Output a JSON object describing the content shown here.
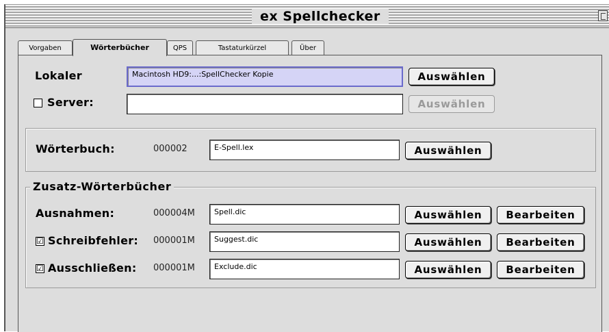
{
  "window": {
    "title": "ex Spellchecker"
  },
  "tabs": [
    {
      "label": "Vorgaben"
    },
    {
      "label": "Wörterbücher"
    },
    {
      "label": "QPS"
    },
    {
      "label": "Tastaturkürzel"
    },
    {
      "label": "Über"
    }
  ],
  "active_tab": "Wörterbücher",
  "location": {
    "lokaler_label": "Lokaler",
    "lokaler_path": "Macintosh HD9:...:SpellChecker Kopie",
    "server_label": "Server:",
    "server_checked": false,
    "server_path": "",
    "choose_label": "Auswählen"
  },
  "main_dict": {
    "label": "Wörterbuch:",
    "code": "000002",
    "file": "E-Spell.lex",
    "choose_label": "Auswählen"
  },
  "extra_dicts": {
    "title": "Zusatz-Wörterbücher",
    "rows": [
      {
        "label": "Ausnahmen:",
        "has_checkbox": false,
        "checked": false,
        "code": "000004M",
        "file": "Spell.dic",
        "choose_label": "Auswählen",
        "edit_label": "Bearbeiten"
      },
      {
        "label": "Schreibfehler:",
        "has_checkbox": true,
        "checked": true,
        "code": "000001M",
        "file": "Suggest.dic",
        "choose_label": "Auswählen",
        "edit_label": "Bearbeiten"
      },
      {
        "label": "Ausschließen:",
        "has_checkbox": true,
        "checked": true,
        "code": "000001M",
        "file": "Exclude.dic",
        "choose_label": "Auswählen",
        "edit_label": "Bearbeiten"
      }
    ]
  },
  "icons": {
    "checkmark": "☑",
    "zoom_box": "zoom-box-icon"
  }
}
